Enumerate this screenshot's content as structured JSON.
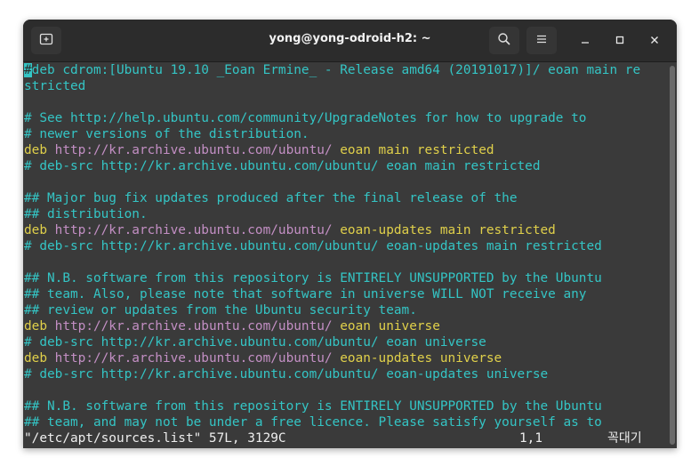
{
  "window": {
    "title": "yong@yong-odroid-h2: ~"
  },
  "titlebar": {
    "new_tab_icon": "new-tab-icon",
    "search_icon": "search-icon",
    "menu_icon": "hamburger-menu-icon",
    "minimize_glyph": "—",
    "maximize_glyph": "☐",
    "close_glyph": "✕"
  },
  "colors": {
    "comment": "#34c5c5",
    "keyword": "#e0d04a",
    "url": "#c38fc4",
    "background": "#3a3a3a",
    "titlebar": "#2c2c2c"
  },
  "lines": [
    [
      {
        "t": "#",
        "c": "cursor"
      },
      {
        "t": "deb cdrom:[Ubuntu 19.10 _Eoan Ermine_ - Release amd64 (20191017)]/ eoan main re",
        "c": "comment"
      }
    ],
    [
      {
        "t": "stricted",
        "c": "comment"
      }
    ],
    [],
    [
      {
        "t": "# See http://help.ubuntu.com/community/UpgradeNotes for how to upgrade to",
        "c": "comment"
      }
    ],
    [
      {
        "t": "# newer versions of the distribution.",
        "c": "comment"
      }
    ],
    [
      {
        "t": "deb",
        "c": "kw"
      },
      {
        "t": " http://kr.archive.ubuntu.com/ubuntu/",
        "c": "url"
      },
      {
        "t": " eoan main restricted",
        "c": "kw"
      }
    ],
    [
      {
        "t": "# deb-src http://kr.archive.ubuntu.com/ubuntu/ eoan main restricted",
        "c": "comment"
      }
    ],
    [],
    [
      {
        "t": "## Major bug fix updates produced after the final release of the",
        "c": "comment"
      }
    ],
    [
      {
        "t": "## distribution.",
        "c": "comment"
      }
    ],
    [
      {
        "t": "deb",
        "c": "kw"
      },
      {
        "t": " http://kr.archive.ubuntu.com/ubuntu/",
        "c": "url"
      },
      {
        "t": " eoan-updates main restricted",
        "c": "kw"
      }
    ],
    [
      {
        "t": "# deb-src http://kr.archive.ubuntu.com/ubuntu/ eoan-updates main restricted",
        "c": "comment"
      }
    ],
    [],
    [
      {
        "t": "## N.B. software from this repository is ENTIRELY UNSUPPORTED by the Ubuntu",
        "c": "comment"
      }
    ],
    [
      {
        "t": "## team. Also, please note that software in universe WILL NOT receive any",
        "c": "comment"
      }
    ],
    [
      {
        "t": "## review or updates from the Ubuntu security team.",
        "c": "comment"
      }
    ],
    [
      {
        "t": "deb",
        "c": "kw"
      },
      {
        "t": " http://kr.archive.ubuntu.com/ubuntu/",
        "c": "url"
      },
      {
        "t": " eoan universe",
        "c": "kw"
      }
    ],
    [
      {
        "t": "# deb-src http://kr.archive.ubuntu.com/ubuntu/ eoan universe",
        "c": "comment"
      }
    ],
    [
      {
        "t": "deb",
        "c": "kw"
      },
      {
        "t": " http://kr.archive.ubuntu.com/ubuntu/",
        "c": "url"
      },
      {
        "t": " eoan-updates universe",
        "c": "kw"
      }
    ],
    [
      {
        "t": "# deb-src http://kr.archive.ubuntu.com/ubuntu/ eoan-updates universe",
        "c": "comment"
      }
    ],
    [],
    [
      {
        "t": "## N.B. software from this repository is ENTIRELY UNSUPPORTED by the Ubuntu",
        "c": "comment"
      }
    ],
    [
      {
        "t": "## team, and may not be under a free licence. Please satisfy yourself as to",
        "c": "comment"
      }
    ]
  ],
  "status": {
    "file_info": "\"/etc/apt/sources.list\" 57L, 3129C",
    "position": "1,1",
    "ime_label": "꼭대기"
  }
}
